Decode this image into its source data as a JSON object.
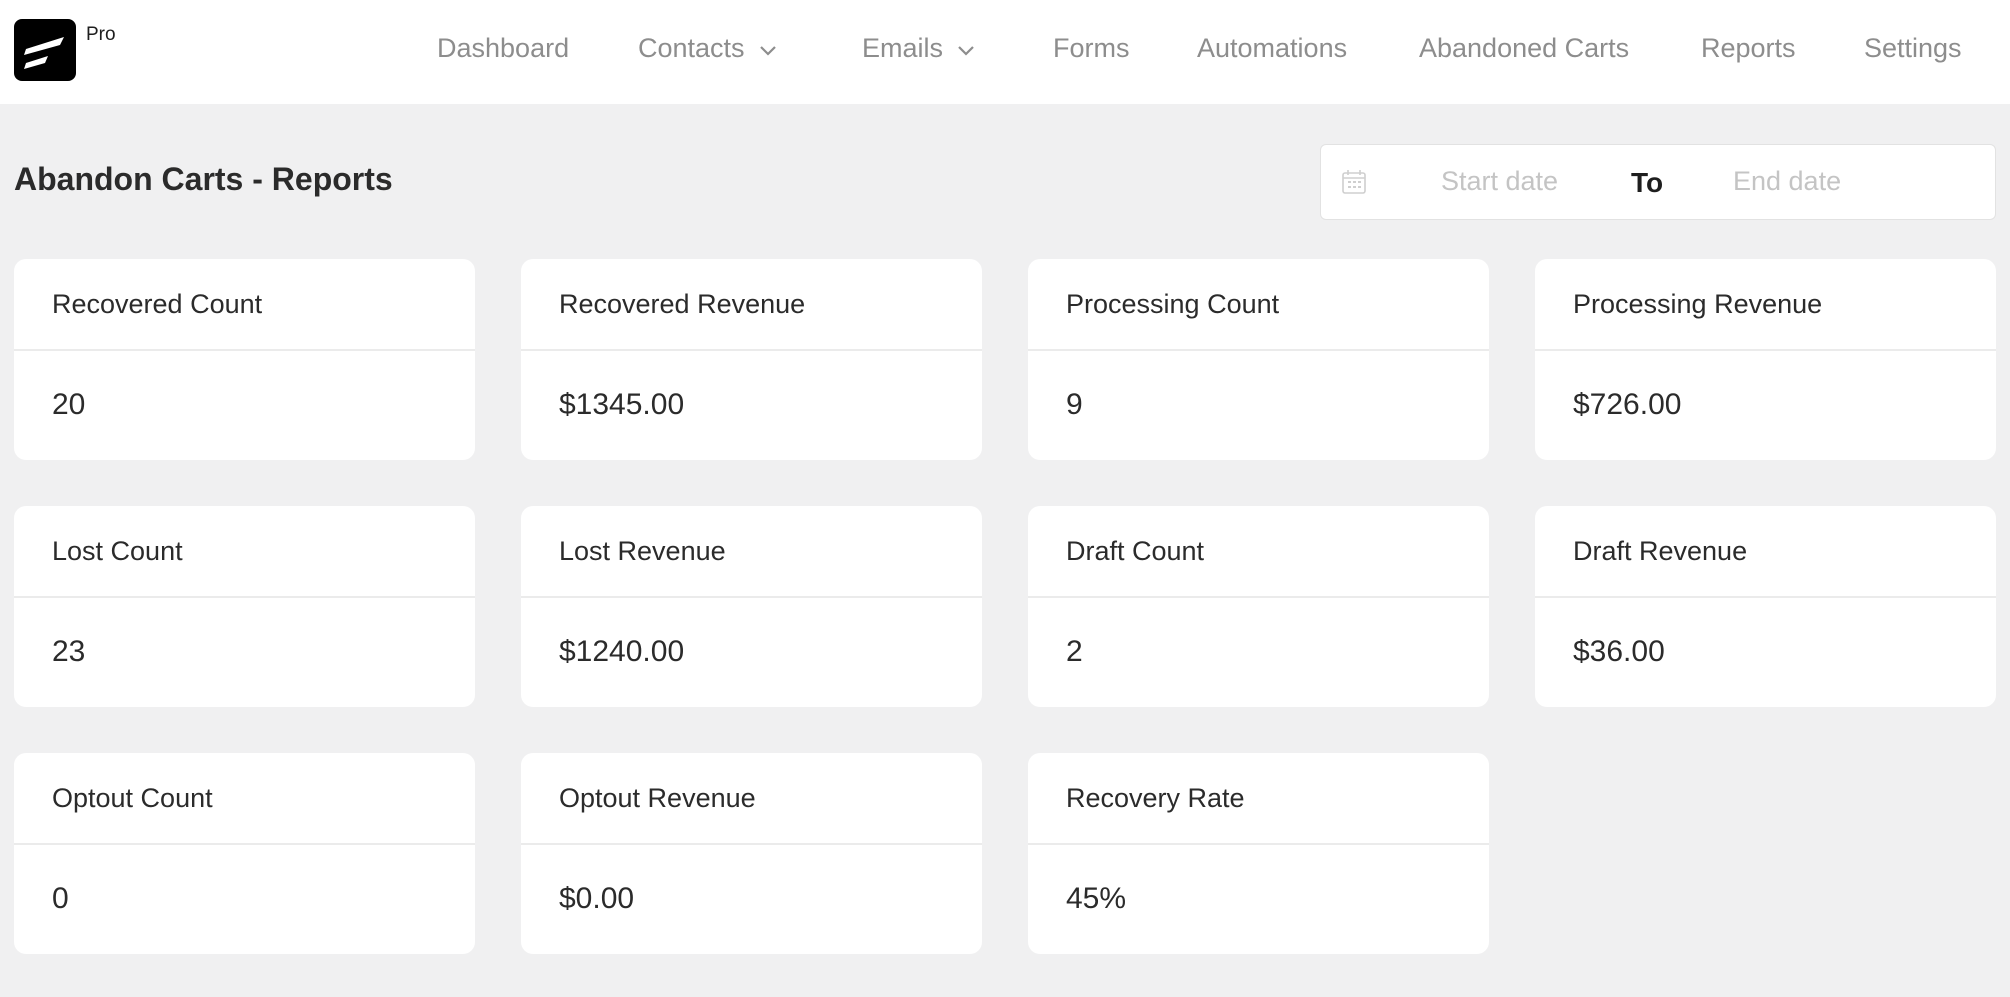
{
  "header": {
    "logo_icon": "fluentcrm-logo-icon",
    "badge": "Pro",
    "nav": [
      {
        "label": "Dashboard",
        "has_dropdown": false
      },
      {
        "label": "Contacts",
        "has_dropdown": true
      },
      {
        "label": "Emails",
        "has_dropdown": true
      },
      {
        "label": "Forms",
        "has_dropdown": false
      },
      {
        "label": "Automations",
        "has_dropdown": false
      },
      {
        "label": "Abandoned Carts",
        "has_dropdown": false
      },
      {
        "label": "Reports",
        "has_dropdown": false
      },
      {
        "label": "Settings",
        "has_dropdown": false
      }
    ]
  },
  "page": {
    "title": "Abandon Carts - Reports"
  },
  "date_filter": {
    "icon": "calendar-icon",
    "start_value": "",
    "start_placeholder": "Start date",
    "separator": "To",
    "end_value": "",
    "end_placeholder": "End date"
  },
  "stats": [
    {
      "label": "Recovered Count",
      "value": "20"
    },
    {
      "label": "Recovered Revenue",
      "value": "$1345.00"
    },
    {
      "label": "Processing Count",
      "value": "9"
    },
    {
      "label": "Processing Revenue",
      "value": "$726.00"
    },
    {
      "label": "Lost Count",
      "value": "23"
    },
    {
      "label": "Lost Revenue",
      "value": "$1240.00"
    },
    {
      "label": "Draft Count",
      "value": "2"
    },
    {
      "label": "Draft Revenue",
      "value": "$36.00"
    },
    {
      "label": "Optout Count",
      "value": "0"
    },
    {
      "label": "Optout Revenue",
      "value": "$0.00"
    },
    {
      "label": "Recovery Rate",
      "value": "45%"
    }
  ]
}
